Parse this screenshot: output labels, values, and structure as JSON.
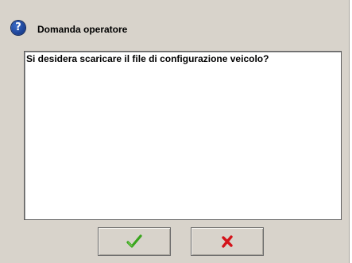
{
  "dialog": {
    "title": "Domanda operatore",
    "message": "Si desidera scaricare il file di configurazione veicolo?",
    "header_icon": "question-icon",
    "buttons": {
      "confirm_icon": "check-icon",
      "confirm_color": "#3aa51e",
      "cancel_icon": "cross-icon",
      "cancel_color": "#d4131a"
    }
  }
}
